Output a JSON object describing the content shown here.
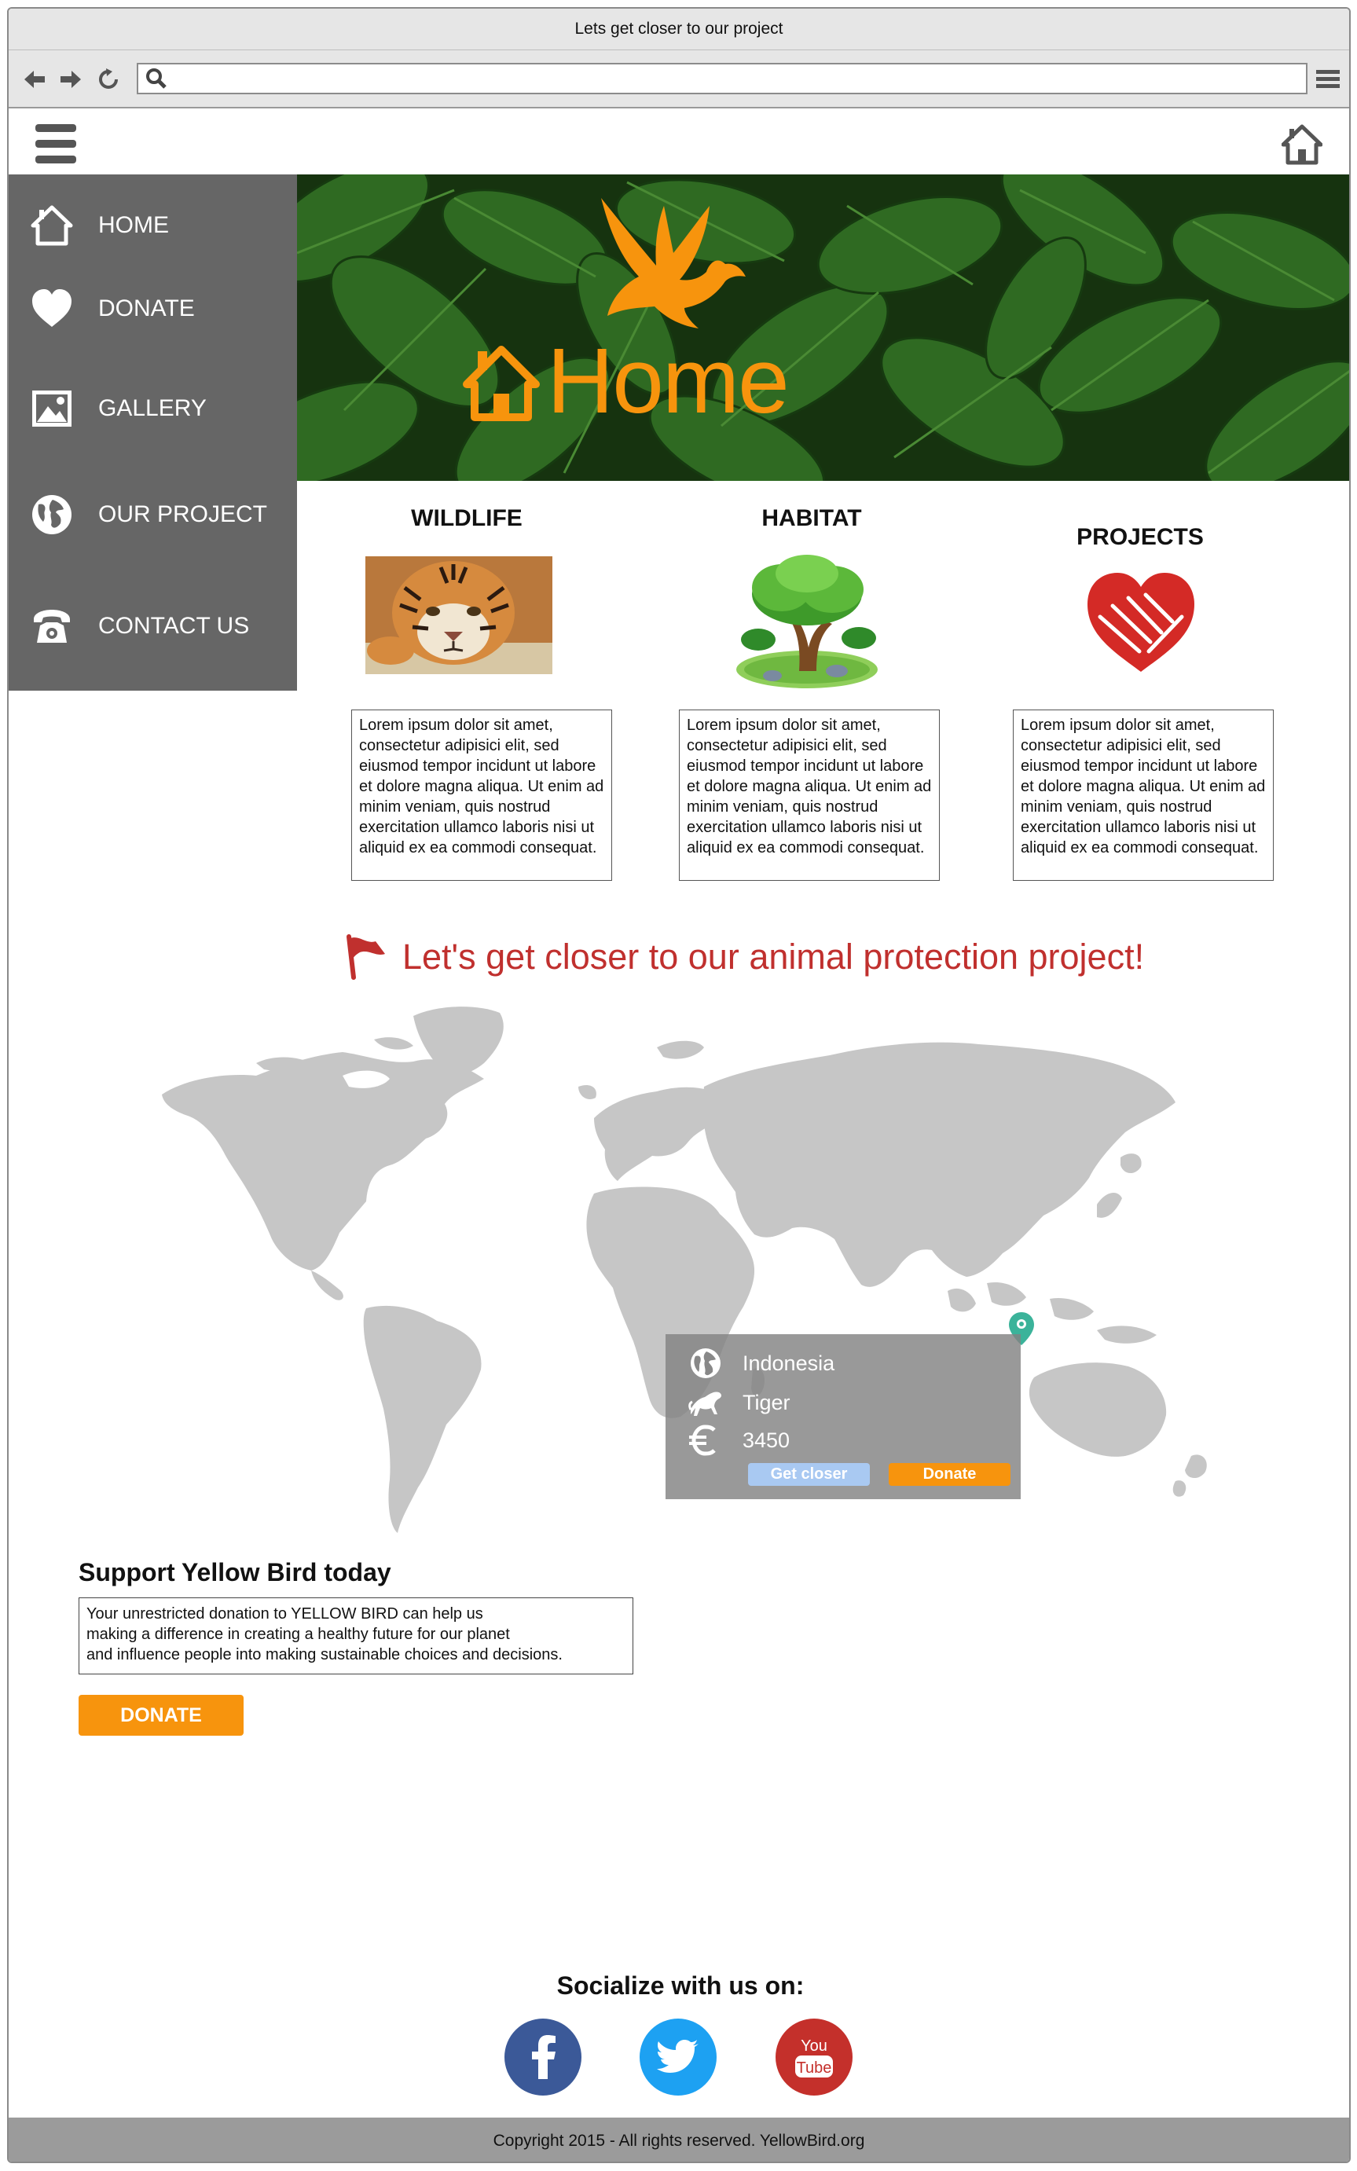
{
  "browser": {
    "window_title": "Lets get closer to our project",
    "address_value": "",
    "icons": [
      "back-arrow-icon",
      "forward-arrow-icon",
      "reload-icon",
      "search-icon",
      "menu-icon"
    ]
  },
  "header": {
    "icons": [
      "hamburger-menu-icon",
      "home-icon"
    ]
  },
  "sidebar": {
    "items": [
      {
        "label": "HOME",
        "icon": "home-icon"
      },
      {
        "label": "DONATE",
        "icon": "heart-icon"
      },
      {
        "label": "GALLERY",
        "icon": "picture-icon"
      },
      {
        "label": "OUR PROJECT",
        "icon": "globe-icon"
      },
      {
        "label": "CONTACT US",
        "icon": "telephone-icon"
      }
    ]
  },
  "hero": {
    "title": "Home",
    "icons": [
      "bird-logo-icon",
      "home-icon"
    ],
    "colors": {
      "accent": "#f7940d",
      "foliage": "#1e4a16"
    }
  },
  "columns": [
    {
      "title": "WILDLIFE",
      "image": "tiger-photo",
      "text": "Lorem ipsum dolor sit amet, consectetur adipisici elit, sed eiusmod tempor incidunt ut labore et dolore magna aliqua. Ut enim ad minim veniam, quis nostrud exercitation ullamco laboris nisi ut aliquid ex ea commodi consequat."
    },
    {
      "title": "HABITAT",
      "image": "tree-illustration",
      "text": "Lorem ipsum dolor sit amet, consectetur adipisici elit, sed eiusmod tempor incidunt ut labore et dolore magna aliqua. Ut enim ad minim veniam, quis nostrud exercitation ullamco laboris nisi ut aliquid ex ea commodi consequat."
    },
    {
      "title": "PROJECTS",
      "image": "heart-hands-icon",
      "text": "Lorem ipsum dolor sit amet, consectetur adipisici elit, sed eiusmod tempor incidunt ut labore et dolore magna aliqua. Ut enim ad minim veniam, quis nostrud exercitation ullamco laboris nisi ut aliquid ex ea commodi consequat."
    }
  ],
  "project_section": {
    "heading": "Let's get closer to our animal protection project!",
    "heading_color": "#c0302e",
    "icon": "flag-icon",
    "map": "world-map",
    "popup": {
      "country": "Indonesia",
      "animal": "Tiger",
      "amount": "3450",
      "icons": [
        "globe-icon",
        "tiger-silhouette-icon",
        "euro-icon"
      ],
      "get_closer_label": "Get closer",
      "donate_label": "Donate"
    }
  },
  "support": {
    "title": "Support Yellow Bird today",
    "lines": [
      "Your unrestricted donation to YELLOW BIRD can help us",
      "making a difference in creating a healthy future for our planet",
      "and influence people into making sustainable choices and decisions."
    ],
    "button_label": "DONATE"
  },
  "social": {
    "title": "Socialize with us on:",
    "networks": [
      {
        "name": "facebook",
        "icon": "facebook-icon",
        "color": "#3b5998"
      },
      {
        "name": "twitter",
        "icon": "twitter-icon",
        "color": "#1da1f2"
      },
      {
        "name": "youtube",
        "icon": "youtube-icon",
        "color": "#c4302b"
      }
    ],
    "youtube_text_top": "You",
    "youtube_text_bottom": "Tube"
  },
  "footer": {
    "text": "Copyright 2015  - All rights reserved. YellowBird.org"
  }
}
